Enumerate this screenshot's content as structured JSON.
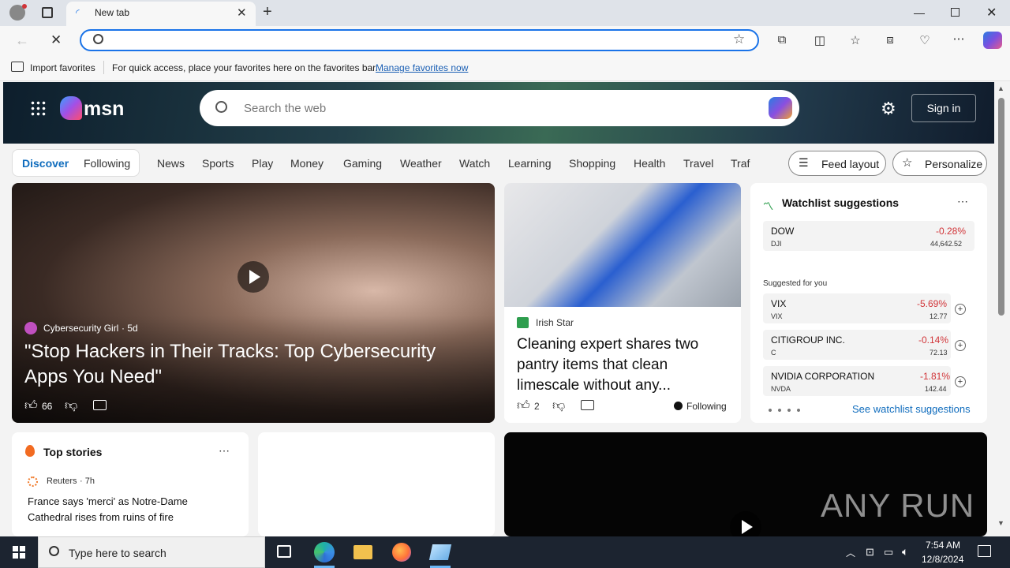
{
  "browser": {
    "tab_title": "New tab",
    "address_placeholder": "",
    "favorites_import": "Import favorites",
    "favorites_hint": "For quick access, place your favorites here on the favorites bar.",
    "favorites_manage": "Manage favorites now"
  },
  "msn": {
    "logo": "msn",
    "search_placeholder": "Search the web",
    "sign_in": "Sign in",
    "tabs": [
      "Discover",
      "Following"
    ],
    "nav": [
      "News",
      "Sports",
      "Play",
      "Money",
      "Gaming",
      "Weather",
      "Watch",
      "Learning",
      "Shopping",
      "Health",
      "Travel",
      "Traf"
    ],
    "feed_layout": "Feed layout",
    "personalize": "Personalize"
  },
  "hero": {
    "source": "Cybersecurity Girl",
    "age": "· 5d",
    "title": "\"Stop Hackers in Their Tracks: Top Cybersecurity Apps You Need\"",
    "likes": "66"
  },
  "card2": {
    "source": "Irish Star",
    "title": "Cleaning expert shares two pantry items that clean limescale without any...",
    "likes": "2",
    "following": "Following"
  },
  "watchlist": {
    "title": "Watchlist suggestions",
    "main": {
      "name": "DOW",
      "symbol": "DJI",
      "change": "-0.28%",
      "price": "44,642.52"
    },
    "suggested_label": "Suggested for you",
    "items": [
      {
        "name": "VIX",
        "symbol": "VIX",
        "change": "-5.69%",
        "price": "12.77"
      },
      {
        "name": "CITIGROUP INC.",
        "symbol": "C",
        "change": "-0.14%",
        "price": "72.13"
      },
      {
        "name": "NVIDIA CORPORATION",
        "symbol": "NVDA",
        "change": "-1.81%",
        "price": "142.44"
      }
    ],
    "see_more": "See watchlist suggestions"
  },
  "topstories": {
    "title": "Top stories",
    "source": "Reuters",
    "age": "· 7h",
    "headline": "France says 'merci' as Notre-Dame Cathedral rises from ruins of fire"
  },
  "video": {
    "watermark": "ANY RUN"
  },
  "taskbar": {
    "search_placeholder": "Type here to search",
    "time": "7:54 AM",
    "date": "12/8/2024"
  },
  "colors": {
    "accent": "#0f6cbd",
    "negative": "#d13438",
    "taskbar": "#1c2430"
  }
}
